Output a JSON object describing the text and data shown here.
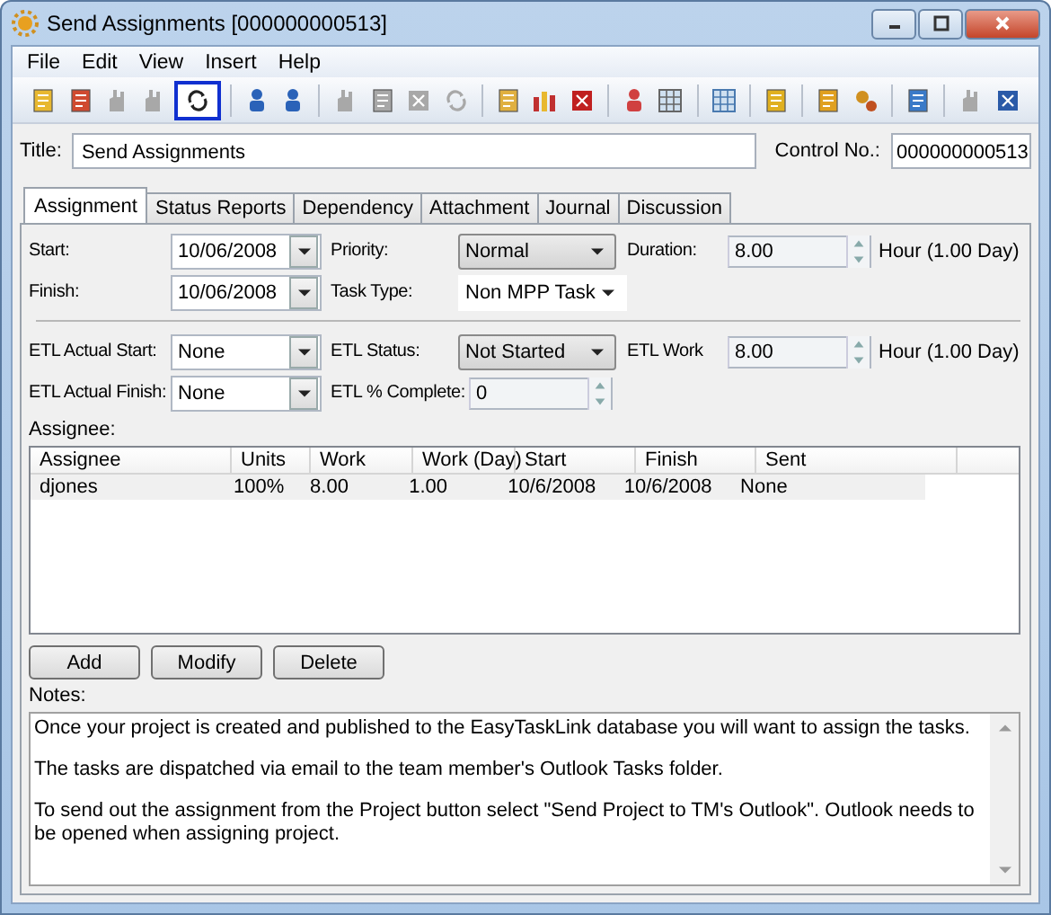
{
  "window": {
    "title": "Send Assignments [000000000513]"
  },
  "menu": [
    "File",
    "Edit",
    "View",
    "Insert",
    "Help"
  ],
  "toolbar": [
    {
      "kind": "clipboard",
      "disabled": false,
      "selected": false
    },
    {
      "kind": "notebook",
      "disabled": false,
      "selected": false
    },
    {
      "kind": "hand",
      "disabled": true,
      "selected": false
    },
    {
      "kind": "hand",
      "disabled": true,
      "selected": false
    },
    {
      "kind": "refresh",
      "disabled": false,
      "selected": true
    },
    {
      "kind": "separator"
    },
    {
      "kind": "user-left",
      "disabled": false,
      "selected": false
    },
    {
      "kind": "user-right",
      "disabled": false,
      "selected": false
    },
    {
      "kind": "separator"
    },
    {
      "kind": "pin",
      "disabled": true,
      "selected": false
    },
    {
      "kind": "page",
      "disabled": true,
      "selected": false
    },
    {
      "kind": "square",
      "disabled": true,
      "selected": false
    },
    {
      "kind": "undo",
      "disabled": true,
      "selected": false
    },
    {
      "kind": "separator"
    },
    {
      "kind": "book",
      "disabled": false,
      "selected": false
    },
    {
      "kind": "chart",
      "disabled": false,
      "selected": false
    },
    {
      "kind": "letter",
      "disabled": false,
      "selected": false
    },
    {
      "kind": "separator"
    },
    {
      "kind": "person",
      "disabled": false,
      "selected": false
    },
    {
      "kind": "calendar",
      "disabled": false,
      "selected": false
    },
    {
      "kind": "separator"
    },
    {
      "kind": "grid",
      "disabled": false,
      "selected": false
    },
    {
      "kind": "separator"
    },
    {
      "kind": "sync",
      "disabled": false,
      "selected": false
    },
    {
      "kind": "separator"
    },
    {
      "kind": "notepad",
      "disabled": false,
      "selected": false
    },
    {
      "kind": "gears",
      "disabled": false,
      "selected": false
    },
    {
      "kind": "separator"
    },
    {
      "kind": "pencil",
      "disabled": false,
      "selected": false
    },
    {
      "kind": "separator"
    },
    {
      "kind": "hand",
      "disabled": true,
      "selected": false
    },
    {
      "kind": "excel",
      "disabled": false,
      "selected": false
    }
  ],
  "title_field": {
    "label": "Title:",
    "value": "Send Assignments"
  },
  "control_no": {
    "label": "Control No.:",
    "value": "000000000513"
  },
  "tabs": [
    {
      "label": "Assignment",
      "selected": true
    },
    {
      "label": "Status Reports",
      "selected": false
    },
    {
      "label": "Dependency",
      "selected": false
    },
    {
      "label": "Attachment",
      "selected": false
    },
    {
      "label": "Journal",
      "selected": false
    },
    {
      "label": "Discussion",
      "selected": false
    }
  ],
  "form_rows": [
    [
      {
        "label": "Start:",
        "kind": "date",
        "value": "10/06/2008"
      },
      {
        "label": "Priority:",
        "kind": "combo-button",
        "value": "Normal"
      },
      {
        "label": "Duration:",
        "kind": "spin",
        "value": "8.00",
        "unit": "Hour (1.00 Day)"
      }
    ],
    [
      {
        "label": "Finish:",
        "kind": "date",
        "value": "10/06/2008"
      },
      {
        "label": "Task Type:",
        "kind": "combo",
        "value": "Non MPP Task"
      }
    ],
    [
      {
        "label": "ETL Actual Start:",
        "kind": "date",
        "value": "None"
      },
      {
        "label": "ETL Status:",
        "kind": "combo-button",
        "value": "Not Started"
      },
      {
        "label": "ETL Work",
        "kind": "spin",
        "value": "8.00",
        "unit": "Hour (1.00 Day)"
      }
    ],
    [
      {
        "label": "ETL Actual Finish:",
        "kind": "date",
        "value": "None"
      },
      {
        "label": "ETL % Complete:",
        "kind": "spin",
        "value": "0"
      }
    ]
  ],
  "assignee_label": "Assignee:",
  "table": {
    "columns": [
      "Assignee",
      "Units",
      "Work",
      "Work (Day)",
      "Start",
      "Finish",
      "Sent"
    ],
    "rows": [
      [
        "djones",
        "100%",
        "8.00",
        "1.00",
        "10/6/2008",
        "10/6/2008",
        "None"
      ]
    ]
  },
  "buttons": [
    "Add",
    "Modify",
    "Delete"
  ],
  "notes_label": "Notes:",
  "notes": [
    "Once your project is created and published to the EasyTaskLink database you will want to assign the tasks.",
    "The tasks are dispatched via email to the team member's Outlook Tasks folder.",
    "To send out the assignment from the Project button select \"Send Project to TM's Outlook\".  Outlook needs to be opened when assigning project."
  ]
}
